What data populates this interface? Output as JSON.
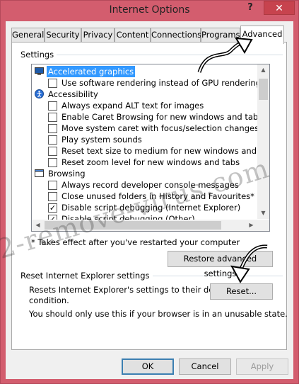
{
  "window": {
    "title": "Internet Options",
    "help": "?",
    "close": "✕"
  },
  "tabs": [
    {
      "label": "General"
    },
    {
      "label": "Security"
    },
    {
      "label": "Privacy"
    },
    {
      "label": "Content"
    },
    {
      "label": "Connections"
    },
    {
      "label": "Programs"
    },
    {
      "label": "Advanced"
    }
  ],
  "settings": {
    "group_label": "Settings",
    "items": [
      {
        "kind": "category",
        "icon": "monitor-icon",
        "label": "Accelerated graphics",
        "selected": true
      },
      {
        "kind": "checkbox",
        "label": "Use software rendering instead of GPU rendering*",
        "checked": false
      },
      {
        "kind": "category",
        "icon": "accessibility-icon",
        "label": "Accessibility"
      },
      {
        "kind": "checkbox",
        "label": "Always expand ALT text for images",
        "checked": false
      },
      {
        "kind": "checkbox",
        "label": "Enable Caret Browsing for new windows and tabs",
        "checked": false
      },
      {
        "kind": "checkbox",
        "label": "Move system caret with focus/selection changes",
        "checked": false
      },
      {
        "kind": "checkbox",
        "label": "Play system sounds",
        "checked": false
      },
      {
        "kind": "checkbox",
        "label": "Reset text size to medium for new windows and tabs",
        "checked": false
      },
      {
        "kind": "checkbox",
        "label": "Reset zoom level for new windows and tabs",
        "checked": false
      },
      {
        "kind": "category",
        "icon": "browsing-icon",
        "label": "Browsing"
      },
      {
        "kind": "checkbox",
        "label": "Always record developer console messages",
        "checked": false
      },
      {
        "kind": "checkbox",
        "label": "Close unused folders in History and Favourites*",
        "checked": false
      },
      {
        "kind": "checkbox",
        "label": "Disable script debugging (Internet Explorer)",
        "checked": true
      },
      {
        "kind": "checkbox",
        "label": "Disable script debugging (Other)",
        "checked": true
      }
    ],
    "note": "* Takes effect after you've restarted your computer",
    "restore_button": "Restore advanced settings"
  },
  "reset": {
    "group_label": "Reset Internet Explorer settings",
    "description_line1": "Resets Internet Explorer's settings to their default",
    "description_line2": "condition.",
    "warning": "You should only use this if your browser is in an unusable state.",
    "button": "Reset..."
  },
  "footer": {
    "ok": "OK",
    "cancel": "Cancel",
    "apply": "Apply"
  },
  "watermark": "2-remove-virus.com",
  "colors": {
    "frame": "#d35d6e",
    "selection": "#3399ff",
    "default_button_border": "#3c7fb1"
  }
}
